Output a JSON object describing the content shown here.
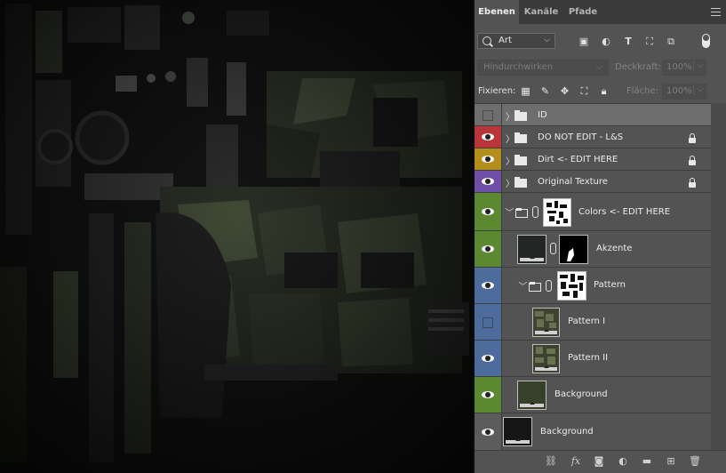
{
  "tabs": [
    "Ebenen",
    "Kanäle",
    "Pfade"
  ],
  "filter": {
    "kind_label": "Art"
  },
  "blend": {
    "mode": "Hindurchwirken",
    "opacity_label": "Deckkraft:",
    "opacity_value": "100%"
  },
  "lock_row": {
    "label": "Fixieren:",
    "fill_label": "Fläche:",
    "fill_value": "100%"
  },
  "layers": [
    {
      "name": "ID",
      "color": "#6e6e6e",
      "visible": false,
      "selected": true,
      "locked": false
    },
    {
      "name": "DO NOT EDIT  - L&S",
      "color": "#b8363a",
      "visible": true,
      "locked": true
    },
    {
      "name": "Dirt <- EDIT HERE",
      "color": "#b48e1a",
      "visible": true,
      "locked": true
    },
    {
      "name": "Original Texture",
      "color": "#6f4ea5",
      "visible": true,
      "locked": true
    },
    {
      "name": "Colors <- EDIT HERE",
      "color": "#5d8832",
      "visible": true
    },
    {
      "name": "Akzente",
      "color": "#5d8832",
      "visible": true
    },
    {
      "name": "Pattern",
      "color": "#4d6c9c",
      "visible": true
    },
    {
      "name": "Pattern I",
      "color": "#4d6c9c",
      "visible": false
    },
    {
      "name": "Pattern II",
      "color": "#4d6c9c",
      "visible": true
    },
    {
      "name": "Background",
      "color": "#5d8832",
      "visible": true
    },
    {
      "name": "Background",
      "color": "#5c5c5c",
      "visible": true
    }
  ],
  "colors": {
    "panel_bg": "#535353",
    "tab_bar": "#3a3a3a",
    "selected_row": "#6e6e6e"
  },
  "icons": [
    "search-icon",
    "image-filter-icon",
    "adjustment-filter-icon",
    "type-filter-icon",
    "shape-filter-icon",
    "smart-object-filter-icon",
    "filter-toggle",
    "lock-transparent-icon",
    "lock-brush-icon",
    "lock-move-icon",
    "lock-artboard-icon",
    "lock-all-icon",
    "link-layers-icon",
    "fx-icon",
    "add-mask-icon",
    "adjustment-layer-icon",
    "new-group-icon",
    "new-layer-icon",
    "delete-icon"
  ]
}
